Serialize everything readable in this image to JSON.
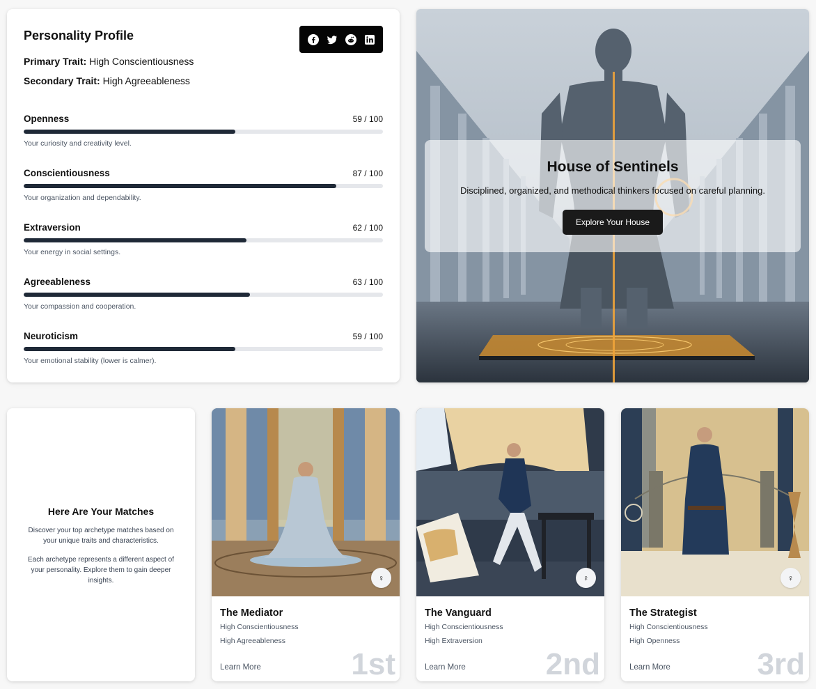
{
  "profile": {
    "title": "Personality Profile",
    "primary_label": "Primary Trait:",
    "primary_value": "High Conscientiousness",
    "secondary_label": "Secondary Trait:",
    "secondary_value": "High Agreeableness",
    "share_icons": [
      "facebook-icon",
      "twitter-icon",
      "reddit-icon",
      "linkedin-icon"
    ],
    "metrics": [
      {
        "name": "Openness",
        "score": 59,
        "score_text": "59 / 100",
        "desc": "Your curiosity and creativity level."
      },
      {
        "name": "Conscientiousness",
        "score": 87,
        "score_text": "87 / 100",
        "desc": "Your organization and dependability."
      },
      {
        "name": "Extraversion",
        "score": 62,
        "score_text": "62 / 100",
        "desc": "Your energy in social settings."
      },
      {
        "name": "Agreeableness",
        "score": 63,
        "score_text": "63 / 100",
        "desc": "Your compassion and cooperation."
      },
      {
        "name": "Neuroticism",
        "score": 59,
        "score_text": "59 / 100",
        "desc": "Your emotional stability (lower is calmer)."
      }
    ]
  },
  "house": {
    "title": "House of Sentinels",
    "description": "Disciplined, organized, and methodical thinkers focused on careful planning.",
    "button": "Explore Your House"
  },
  "matches": {
    "title": "Here Are Your Matches",
    "para1": "Discover your top archetype matches based on your unique traits and characteristics.",
    "para2": "Each archetype represents a different aspect of your personality. Explore them to gain deeper insights."
  },
  "archetypes": [
    {
      "name": "The Mediator",
      "trait1": "High Conscientiousness",
      "trait2": "High Agreeableness",
      "link": "Learn More",
      "rank": "1st",
      "gender": "♀"
    },
    {
      "name": "The Vanguard",
      "trait1": "High Conscientiousness",
      "trait2": "High Extraversion",
      "link": "Learn More",
      "rank": "2nd",
      "gender": "♀"
    },
    {
      "name": "The Strategist",
      "trait1": "High Conscientiousness",
      "trait2": "High Openness",
      "link": "Learn More",
      "rank": "3rd",
      "gender": "♀"
    }
  ],
  "colors": {
    "accent": "#1f2937",
    "track": "#e5e7eb",
    "rank": "#d1d5db",
    "gold": "#e8a33a"
  }
}
